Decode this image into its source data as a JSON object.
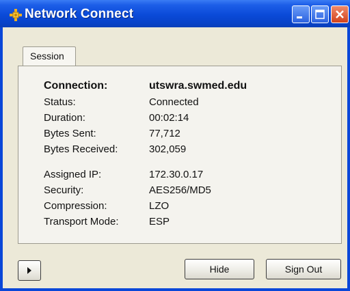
{
  "window": {
    "title": "Network Connect"
  },
  "tabs": [
    {
      "label": "Session"
    }
  ],
  "session": {
    "connection": {
      "label": "Connection:",
      "value": "utswra.swmed.edu"
    },
    "rows_group1": [
      {
        "label": "Status:",
        "value": "Connected"
      },
      {
        "label": "Duration:",
        "value": "00:02:14"
      },
      {
        "label": "Bytes Sent:",
        "value": "77,712"
      },
      {
        "label": "Bytes Received:",
        "value": "302,059"
      }
    ],
    "rows_group2": [
      {
        "label": "Assigned IP:",
        "value": "172.30.0.17"
      },
      {
        "label": "Security:",
        "value": "AES256/MD5"
      },
      {
        "label": "Compression:",
        "value": "LZO"
      },
      {
        "label": "Transport Mode:",
        "value": "ESP"
      }
    ]
  },
  "buttons": {
    "expand_icon": "play-right-icon",
    "hide": "Hide",
    "sign_out": "Sign Out"
  },
  "colors": {
    "titlebar": "#0a4ad8",
    "client": "#ece9d8",
    "close_button": "#d2421c"
  }
}
